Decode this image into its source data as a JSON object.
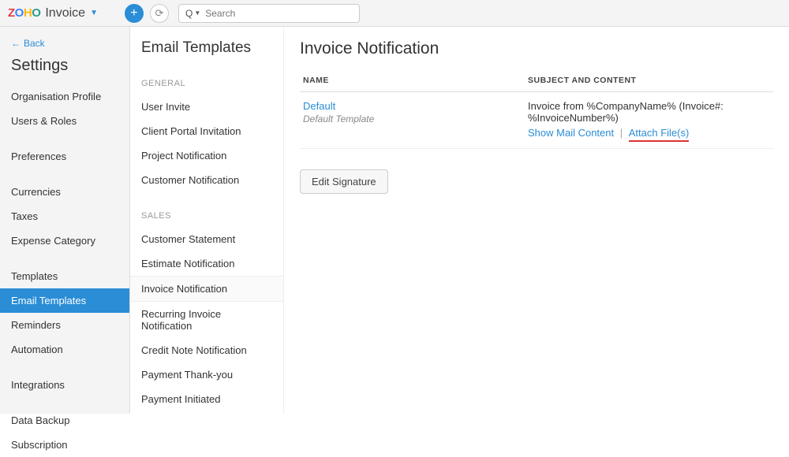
{
  "topbar": {
    "product": "Invoice",
    "search_prefix": "Q",
    "search_placeholder": "Search"
  },
  "sidebar": {
    "back": "Back",
    "heading": "Settings",
    "items": [
      "Organisation Profile",
      "Users & Roles",
      "Preferences",
      "Currencies",
      "Taxes",
      "Expense Category",
      "Templates",
      "Email Templates",
      "Reminders",
      "Automation",
      "Integrations",
      "Data Backup",
      "Subscription"
    ],
    "active_index": 7
  },
  "midpanel": {
    "title": "Email Templates",
    "groups": [
      {
        "label": "GENERAL",
        "items": [
          "User Invite",
          "Client Portal Invitation",
          "Project Notification",
          "Customer Notification"
        ]
      },
      {
        "label": "SALES",
        "items": [
          "Customer Statement",
          "Estimate Notification",
          "Invoice Notification",
          "Recurring Invoice Notification",
          "Credit Note Notification",
          "Payment Thank-you",
          "Payment Initiated"
        ]
      }
    ],
    "active": "Invoice Notification"
  },
  "main": {
    "title": "Invoice Notification",
    "columns": {
      "name": "NAME",
      "subject": "SUBJECT AND CONTENT"
    },
    "row": {
      "name": "Default",
      "subtext": "Default Template",
      "subject": "Invoice from %CompanyName% (Invoice#: %InvoiceNumber%)",
      "show_mail": "Show Mail Content",
      "attach": "Attach File(s)"
    },
    "edit_signature": "Edit Signature"
  }
}
